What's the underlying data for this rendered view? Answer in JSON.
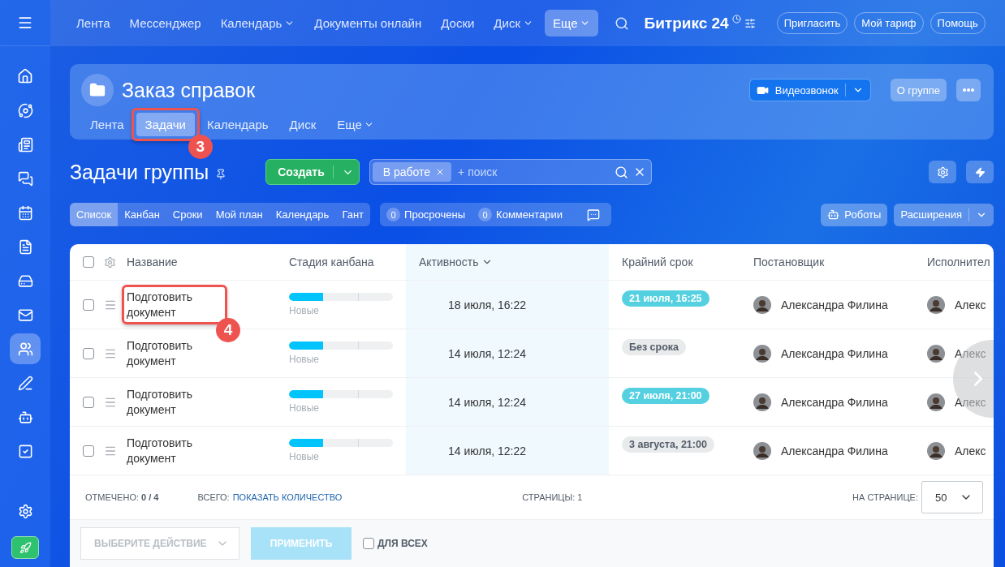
{
  "top_nav": {
    "items": [
      {
        "label": "Лента",
        "dropdown": false,
        "selected": false
      },
      {
        "label": "Мессенджер",
        "dropdown": false,
        "selected": false
      },
      {
        "label": "Календарь",
        "dropdown": true,
        "selected": false
      },
      {
        "label": "Документы онлайн",
        "dropdown": false,
        "selected": false
      },
      {
        "label": "Доски",
        "dropdown": false,
        "selected": false
      },
      {
        "label": "Диск",
        "dropdown": true,
        "selected": false
      },
      {
        "label": "Еще",
        "dropdown": true,
        "selected": true
      }
    ],
    "brand": "Битрикс 24",
    "buttons": [
      "Пригласить",
      "Мой тариф",
      "Помощь"
    ]
  },
  "group": {
    "title": "Заказ справок",
    "video_button": "Видеозвонок",
    "about_button": "О группе",
    "tabs": [
      {
        "label": "Лента",
        "dropdown": false,
        "selected": false
      },
      {
        "label": "Задачи",
        "dropdown": false,
        "selected": true,
        "callout": "3"
      },
      {
        "label": "Календарь",
        "dropdown": false,
        "selected": false
      },
      {
        "label": "Диск",
        "dropdown": false,
        "selected": false
      },
      {
        "label": "Еще",
        "dropdown": true,
        "selected": false
      }
    ]
  },
  "tasks_header": {
    "title": "Задачи группы",
    "create_button": "Создать",
    "filter_chip": "В работе",
    "search_placeholder": "+ поиск"
  },
  "views": [
    {
      "label": "Список",
      "selected": true
    },
    {
      "label": "Канбан",
      "selected": false
    },
    {
      "label": "Сроки",
      "selected": false
    },
    {
      "label": "Мой план",
      "selected": false
    },
    {
      "label": "Календарь",
      "selected": false
    },
    {
      "label": "Гант",
      "selected": false
    }
  ],
  "counters": [
    {
      "count": "0",
      "label": "Просрочены"
    },
    {
      "count": "0",
      "label": "Комментарии"
    }
  ],
  "robots_button": "Роботы",
  "extensions_button": "Расширения",
  "table": {
    "select_all_checked": false,
    "columns": [
      {
        "label": "Название",
        "sorted": false
      },
      {
        "label": "Стадия канбана",
        "sorted": false
      },
      {
        "label": "Активность",
        "sorted": true
      },
      {
        "label": "Крайний срок",
        "sorted": false
      },
      {
        "label": "Постановщик",
        "sorted": false
      },
      {
        "label": "Исполнител",
        "sorted": false
      }
    ],
    "rows": [
      {
        "checked": false,
        "name": "Подготовить документ",
        "callout": "4",
        "stage": {
          "level": 0.33,
          "label": "Новые"
        },
        "activity": "18 июля, 16:22",
        "deadline": {
          "text": "21 июля, 16:25",
          "color": "#55d0e0"
        },
        "creator": "Александра Филина",
        "assignee": "Алекс"
      },
      {
        "checked": false,
        "name": "Подготовить документ",
        "stage": {
          "level": 0.33,
          "label": "Новые"
        },
        "activity": "14 июля, 12:24",
        "deadline": {
          "text": "Без срока",
          "color": "#e8eaeb"
        },
        "creator": "Александра Филина",
        "assignee": "Алекс"
      },
      {
        "checked": false,
        "name": "Подготовить документ",
        "stage": {
          "level": 0.33,
          "label": "Новые"
        },
        "activity": "14 июля, 12:24",
        "deadline": {
          "text": "27 июля, 21:00",
          "color": "#55d0e0"
        },
        "creator": "Александра Филина",
        "assignee": "Алекс"
      },
      {
        "checked": false,
        "name": "Подготовить документ",
        "stage": {
          "level": 0.33,
          "label": "Новые"
        },
        "activity": "14 июля, 12:22",
        "deadline": {
          "text": "3 августа, 21:00",
          "color": "#e8eaeb"
        },
        "creator": "Александра Филина",
        "assignee": "Алекс"
      }
    ]
  },
  "footer": {
    "marked_label": "ОТМЕЧЕНО:",
    "marked_value": "0 / 4",
    "total_label": "ВСЕГО:",
    "total_link": "ПОКАЗАТЬ КОЛИЧЕСТВО",
    "pages_label": "СТРАНИЦЫ:",
    "pages_value": "1",
    "per_page_label": "НА СТРАНИЦЕ:",
    "per_page_value": "50"
  },
  "actions": {
    "action_select": "ВЫБЕРИТЕ ДЕЙСТВИЕ",
    "apply_button": "ПРИМЕНИТЬ",
    "apply_disabled": true,
    "for_all_label": "ДЛЯ ВСЕХ",
    "for_all_checked": false
  }
}
